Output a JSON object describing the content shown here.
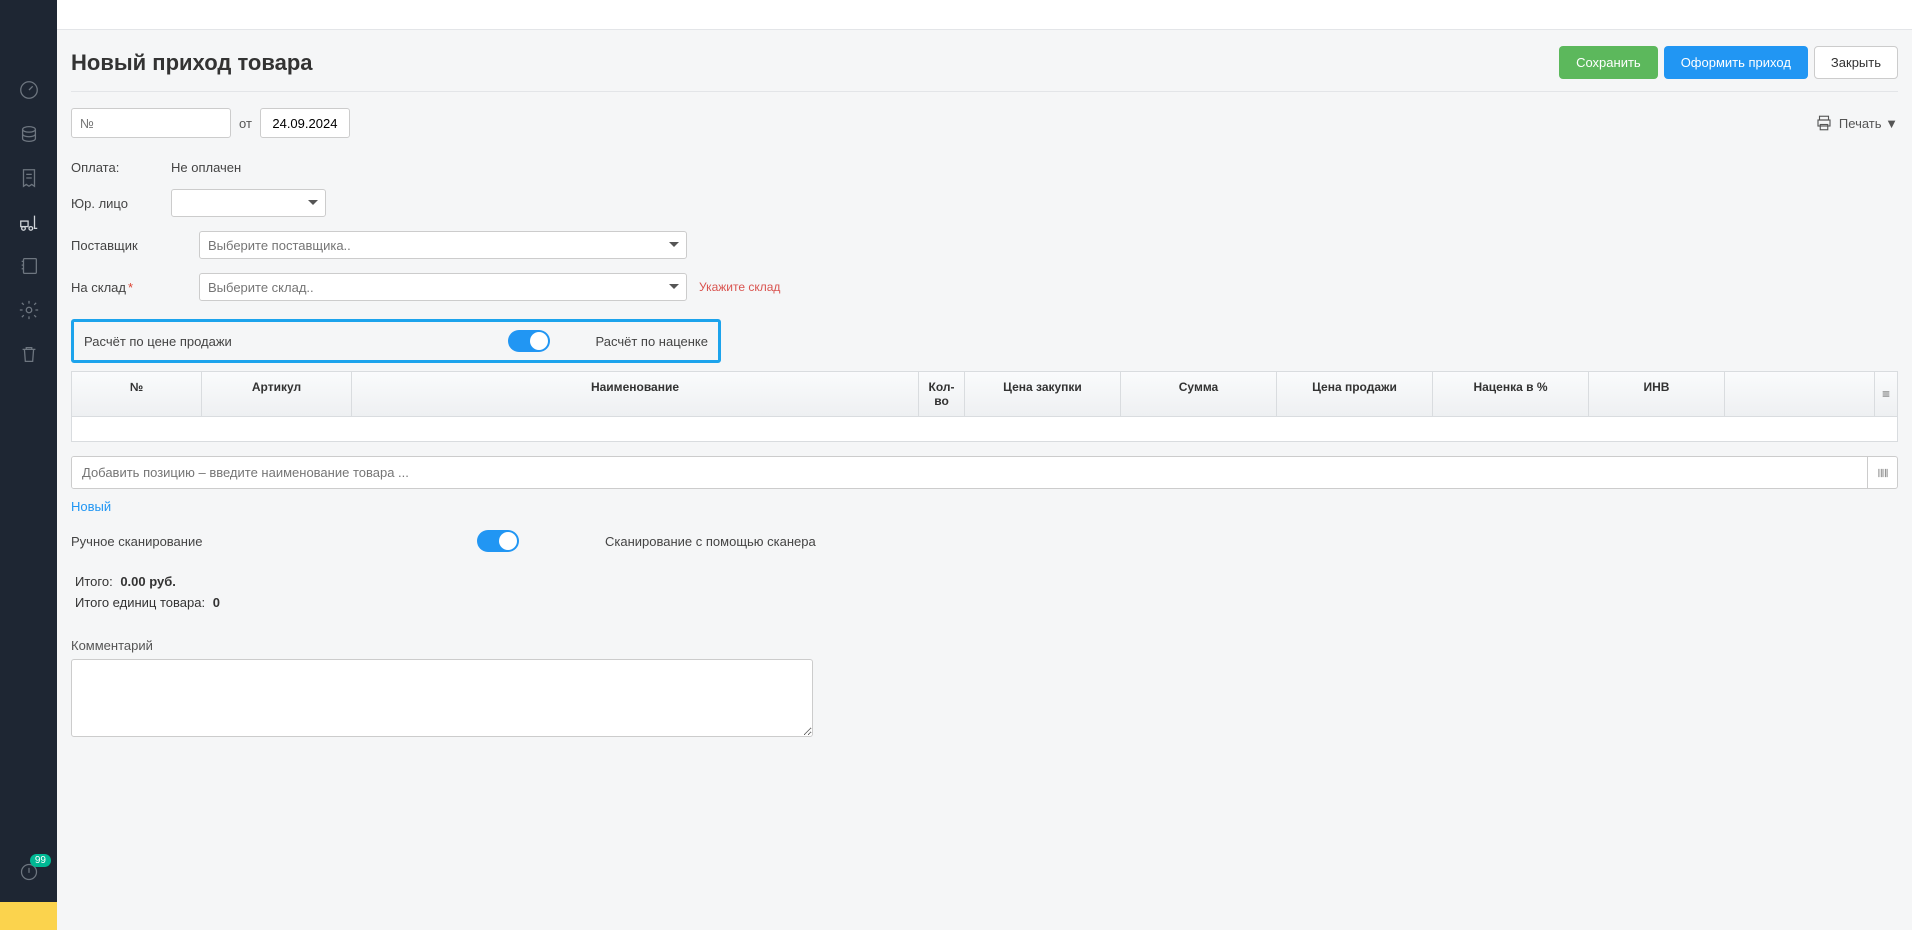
{
  "sidebar": {
    "notification_count": "99"
  },
  "header": {
    "title": "Новый приход товара",
    "save_label": "Сохранить",
    "submit_label": "Оформить приход",
    "close_label": "Закрыть"
  },
  "meta": {
    "number_placeholder": "№",
    "from_label": "от",
    "date_value": "24.09.2024",
    "print_label": "Печать ▼"
  },
  "form": {
    "payment_label": "Оплата:",
    "payment_value": "Не оплачен",
    "legal_label": "Юр. лицо",
    "legal_value": "",
    "supplier_label": "Поставщик",
    "supplier_placeholder": "Выберите поставщика..",
    "warehouse_label": "На склад",
    "warehouse_placeholder": "Выберите склад..",
    "warehouse_error": "Укажите склад"
  },
  "calc": {
    "by_price_label": "Расчёт по цене продажи",
    "by_margin_label": "Расчёт по наценке"
  },
  "table": {
    "cols": {
      "num": "№",
      "article": "Артикул",
      "name": "Наименование",
      "qty": "Кол-во",
      "buy_price": "Цена закупки",
      "sum": "Сумма",
      "sell_price": "Цена продажи",
      "margin": "Наценка в %",
      "inv": "ИНВ"
    }
  },
  "add": {
    "placeholder": "Добавить позицию – введите наименование товара ..."
  },
  "links": {
    "new_label": "Новый"
  },
  "scan": {
    "manual_label": "Ручное сканирование",
    "scanner_label": "Сканирование с помощью сканера"
  },
  "totals": {
    "sum_label": "Итого:",
    "sum_value": "0.00 руб.",
    "units_label": "Итого единиц товара:",
    "units_value": "0"
  },
  "comment": {
    "label": "Комментарий"
  }
}
